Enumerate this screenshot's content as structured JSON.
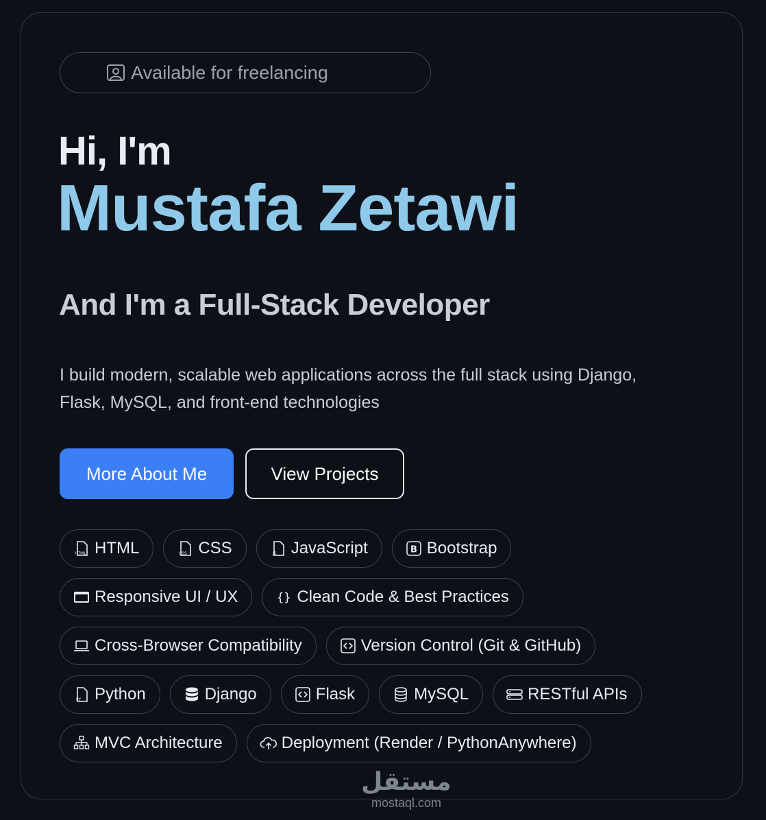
{
  "badge": {
    "label": "Available for freelancing",
    "icon": "person-badge-icon"
  },
  "hero": {
    "greeting": "Hi, I'm",
    "name": "Mustafa Zetawi",
    "role": "And I'm a Full-Stack Developer",
    "description": "I build modern, scalable web applications across the full stack using Django, Flask, MySQL, and front-end technologies"
  },
  "buttons": {
    "primary": "More About Me",
    "secondary": "View Projects"
  },
  "skills": [
    {
      "label": "HTML",
      "icon": "html-file-icon"
    },
    {
      "label": "CSS",
      "icon": "css-file-icon"
    },
    {
      "label": "JavaScript",
      "icon": "js-file-icon"
    },
    {
      "label": "Bootstrap",
      "icon": "bootstrap-icon"
    },
    {
      "label": "Responsive UI / UX",
      "icon": "window-icon"
    },
    {
      "label": "Clean Code & Best Practices",
      "icon": "braces-icon"
    },
    {
      "label": "Cross-Browser Compatibility",
      "icon": "laptop-icon"
    },
    {
      "label": "Version Control (Git & GitHub)",
      "icon": "code-square-icon"
    },
    {
      "label": "Python",
      "icon": "python-file-icon"
    },
    {
      "label": "Django",
      "icon": "database-fill-icon"
    },
    {
      "label": "Flask",
      "icon": "code-square-icon"
    },
    {
      "label": "MySQL",
      "icon": "database-icon"
    },
    {
      "label": "RESTful APIs",
      "icon": "server-icon"
    },
    {
      "label": "MVC Architecture",
      "icon": "diagram-icon"
    },
    {
      "label": "Deployment (Render / PythonAnywhere)",
      "icon": "cloud-upload-icon"
    }
  ],
  "watermark": {
    "arabic": "مستقل",
    "latin": "mostaql.com"
  },
  "colors": {
    "background": "#0d1117",
    "accent_name": "#8fc9ea",
    "primary_button": "#3b7ef6",
    "chip_border": "#3d444d"
  }
}
